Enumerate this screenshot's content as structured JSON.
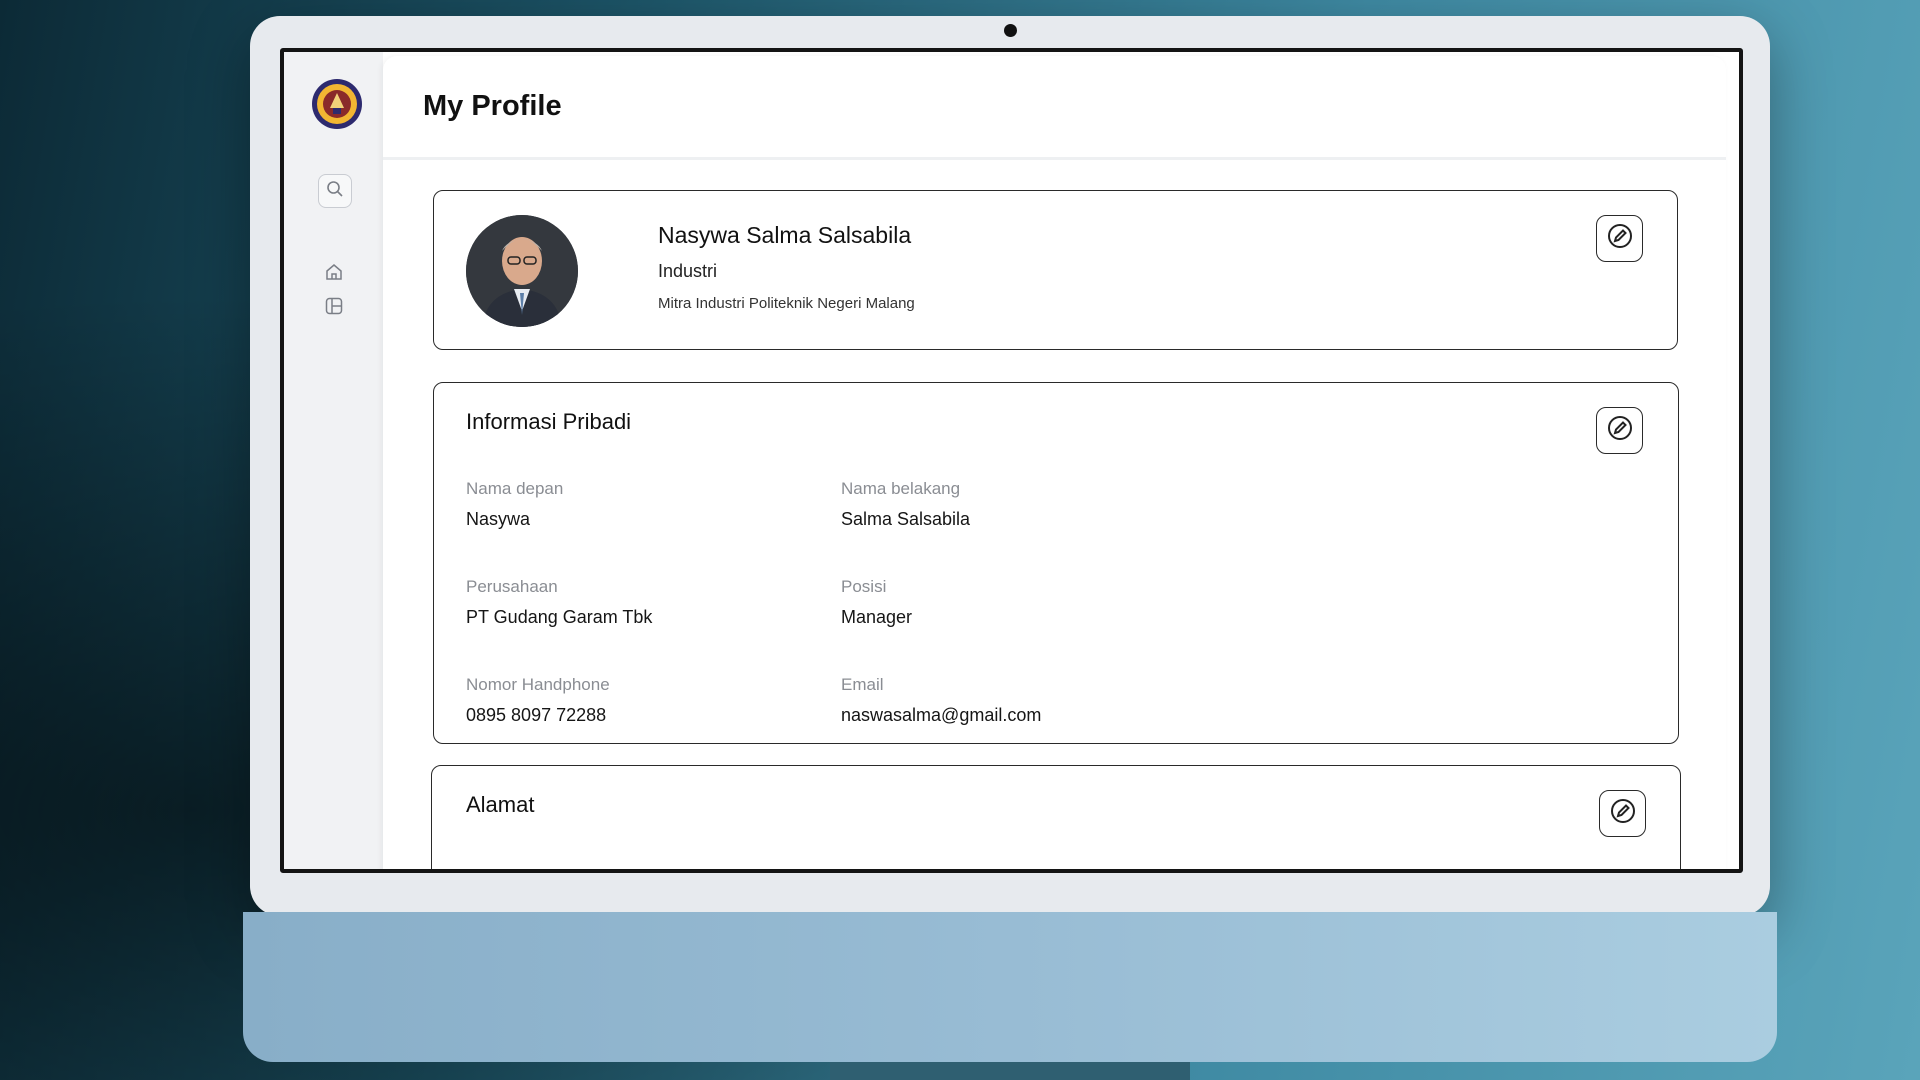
{
  "page": {
    "title": "My Profile"
  },
  "sidebar": {
    "logo": "institution-logo",
    "items": [
      {
        "icon": "search-icon"
      },
      {
        "icon": "home-icon"
      },
      {
        "icon": "dashboard-icon"
      }
    ]
  },
  "profile": {
    "name": "Nasywa Salma Salsabila",
    "role": "Industri",
    "organization": "Mitra Industri Politeknik Negeri Malang"
  },
  "personal_info": {
    "title": "Informasi Pribadi",
    "first_name_label": "Nama depan",
    "first_name": "Nasywa",
    "last_name_label": "Nama belakang",
    "last_name": "Salma Salsabila",
    "company_label": "Perusahaan",
    "company": "PT Gudang Garam Tbk",
    "position_label": "Posisi",
    "position": "Manager",
    "phone_label": "Nomor Handphone",
    "phone": "0895 8097 72288",
    "email_label": "Email",
    "email": "naswasalma@gmail.com"
  },
  "address": {
    "title": "Alamat"
  },
  "colors": {
    "border": "#2a2a2a",
    "label": "#8a8d93",
    "sidebar_bg": "#f1f2f4",
    "logo_ring": "#2d2a6e",
    "logo_fill": "#f2b632"
  }
}
